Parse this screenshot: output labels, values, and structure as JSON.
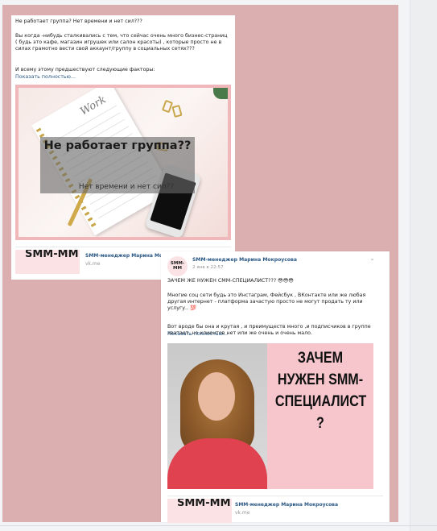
{
  "post1": {
    "text_line1": "Не работает группа? Нет времени и нет сил???",
    "text_para2": "Вы когда -нибудь сталкивались с тем, что сейчас очень много бизнес-страниц ( будь это кафе, магазин игрушек или салон красоты) , которые просто не в силах грамотно вести свой аккаунт/группу в социальных сетях???",
    "text_para3": "И всему этому предшествуют следующие факторы:",
    "show_more": "Показать полностью...",
    "image": {
      "notebook_text": "Work",
      "title": "Не работает группа??",
      "subtitle": "Нет времени и нет сил??"
    },
    "share": {
      "thumb_text": "SMM-ММ",
      "title": "SMM-менеджер Марина Мокр",
      "url": "vk.me"
    }
  },
  "post2": {
    "avatar_text": "SMM-ММ",
    "author": "SMM-менеджер Марина Мокроусова",
    "date": "2 янв в 22:57",
    "menu_icon": "chevron-down-icon",
    "text_line1": "ЗАЧЕМ ЖЕ НУЖЕН СММ-СПЕЦИАЛИСТ??? 😳😳😳",
    "text_para2": "Многие соц сети будь это Инстаграм, Фейсбук , ВКонтакте или же любая другая интернет - платформа зачастую просто не могут продать ту или услугу.. 💯",
    "text_para3": "Вот вроде бы она и крутая , и преимуществ много ,и подписчиков в группе хватает, но клиентов нет или же очень и очень мало.",
    "show_more": "Показать полностью...",
    "image": {
      "headline": "ЗАЧЕМ НУЖЕН SMM-СПЕЦИАЛИСТ ?"
    },
    "share": {
      "thumb_text": "SMM-ММ",
      "title": "SMM-менеджер Марина Мокроусова",
      "url": "vk.me"
    }
  },
  "colors": {
    "background_pink": "#dbaeb0",
    "link_blue": "#2a5885",
    "image_border_pink": "#f0b8ba",
    "poster_pink": "#f6c6cc",
    "shirt_red": "#e04250"
  }
}
